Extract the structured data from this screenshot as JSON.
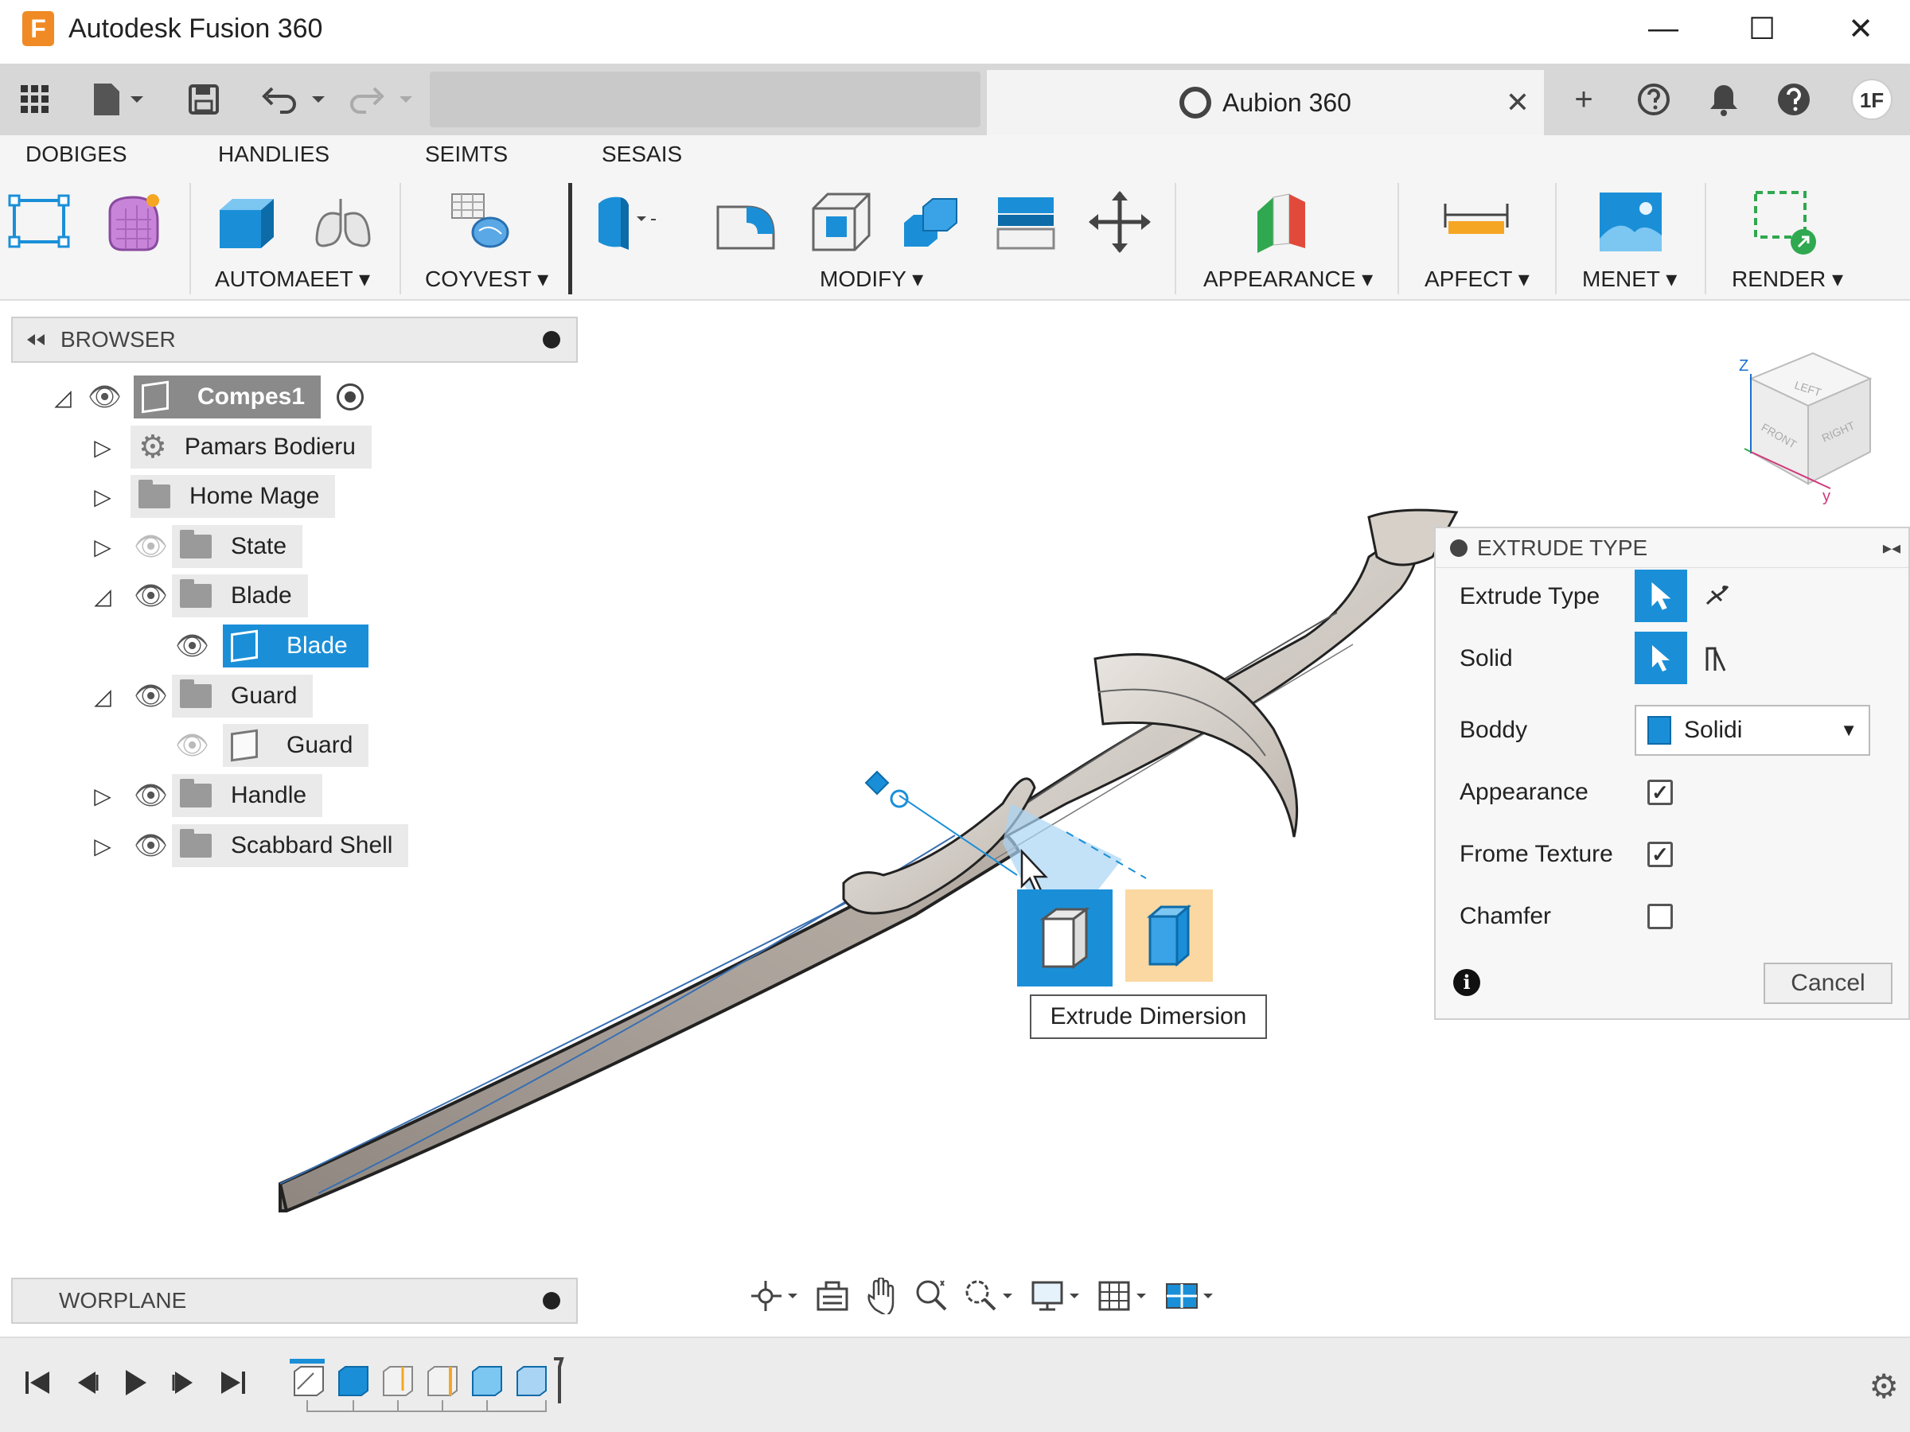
{
  "window": {
    "title": "Autodesk Fusion 360",
    "logo_letter": "F",
    "minimize": "—",
    "maximize": "☐",
    "close": "✕"
  },
  "tabs": {
    "document_tab": "Aubion 360",
    "close_tab": "✕",
    "right_icons": [
      "+",
      "?",
      "🔔",
      "?",
      "1F"
    ]
  },
  "ribbon": {
    "tabs": [
      "DOBIGES",
      "HANDLIES",
      "SEIMTS",
      "SESAIS"
    ],
    "groups": [
      "AUTOMAEET ▾",
      "COYVEST ▾",
      "MODIFY ▾",
      "APPEARANCE ▾",
      "APFECT ▾",
      "MENET ▾",
      "RENDER ▾"
    ]
  },
  "browser": {
    "title": "BROWSER",
    "items": [
      {
        "label": "Compes1"
      },
      {
        "label": "Pamars Bodieru"
      },
      {
        "label": "Home Mage"
      },
      {
        "label": "State"
      },
      {
        "label": "Blade"
      },
      {
        "label": "Blade"
      },
      {
        "label": "Guard"
      },
      {
        "label": "Guard"
      },
      {
        "label": "Handle"
      },
      {
        "label": "Scabbard Shell"
      }
    ]
  },
  "viewcube": {
    "z": "Z",
    "y": "y",
    "faces": [
      "LEFT",
      "FRONT",
      "RIGHT"
    ]
  },
  "extrude": {
    "title": "EXTRUDE TYPE",
    "rows": {
      "extrude_type": "Extrude Type",
      "solid": "Solid",
      "body": "Boddy",
      "body_value": "Solidi",
      "appearance": "Appearance",
      "frame_texture": "Frome Texture",
      "chamfer": "Chamfer"
    },
    "appearance_checked": true,
    "frame_texture_checked": true,
    "chamfer_checked": false,
    "cancel": "Cancel",
    "info": "i"
  },
  "tooltip": "Extrude Dimersion",
  "workplane": {
    "title": "WORPLANE"
  },
  "colors": {
    "accent": "#1a8fd8",
    "orange": "#f08a24",
    "blade": "#9b928a"
  }
}
